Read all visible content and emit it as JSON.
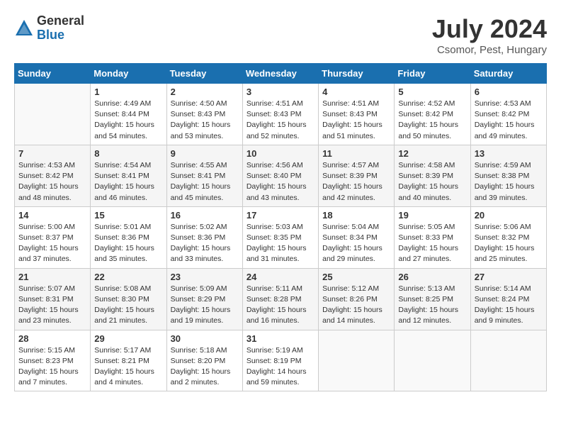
{
  "header": {
    "logo_general": "General",
    "logo_blue": "Blue",
    "month_title": "July 2024",
    "location": "Csomor, Pest, Hungary"
  },
  "days_header": [
    "Sunday",
    "Monday",
    "Tuesday",
    "Wednesday",
    "Thursday",
    "Friday",
    "Saturday"
  ],
  "weeks": [
    [
      {
        "day": "",
        "info": ""
      },
      {
        "day": "1",
        "info": "Sunrise: 4:49 AM\nSunset: 8:44 PM\nDaylight: 15 hours\nand 54 minutes."
      },
      {
        "day": "2",
        "info": "Sunrise: 4:50 AM\nSunset: 8:43 PM\nDaylight: 15 hours\nand 53 minutes."
      },
      {
        "day": "3",
        "info": "Sunrise: 4:51 AM\nSunset: 8:43 PM\nDaylight: 15 hours\nand 52 minutes."
      },
      {
        "day": "4",
        "info": "Sunrise: 4:51 AM\nSunset: 8:43 PM\nDaylight: 15 hours\nand 51 minutes."
      },
      {
        "day": "5",
        "info": "Sunrise: 4:52 AM\nSunset: 8:42 PM\nDaylight: 15 hours\nand 50 minutes."
      },
      {
        "day": "6",
        "info": "Sunrise: 4:53 AM\nSunset: 8:42 PM\nDaylight: 15 hours\nand 49 minutes."
      }
    ],
    [
      {
        "day": "7",
        "info": "Sunrise: 4:53 AM\nSunset: 8:42 PM\nDaylight: 15 hours\nand 48 minutes."
      },
      {
        "day": "8",
        "info": "Sunrise: 4:54 AM\nSunset: 8:41 PM\nDaylight: 15 hours\nand 46 minutes."
      },
      {
        "day": "9",
        "info": "Sunrise: 4:55 AM\nSunset: 8:41 PM\nDaylight: 15 hours\nand 45 minutes."
      },
      {
        "day": "10",
        "info": "Sunrise: 4:56 AM\nSunset: 8:40 PM\nDaylight: 15 hours\nand 43 minutes."
      },
      {
        "day": "11",
        "info": "Sunrise: 4:57 AM\nSunset: 8:39 PM\nDaylight: 15 hours\nand 42 minutes."
      },
      {
        "day": "12",
        "info": "Sunrise: 4:58 AM\nSunset: 8:39 PM\nDaylight: 15 hours\nand 40 minutes."
      },
      {
        "day": "13",
        "info": "Sunrise: 4:59 AM\nSunset: 8:38 PM\nDaylight: 15 hours\nand 39 minutes."
      }
    ],
    [
      {
        "day": "14",
        "info": "Sunrise: 5:00 AM\nSunset: 8:37 PM\nDaylight: 15 hours\nand 37 minutes."
      },
      {
        "day": "15",
        "info": "Sunrise: 5:01 AM\nSunset: 8:36 PM\nDaylight: 15 hours\nand 35 minutes."
      },
      {
        "day": "16",
        "info": "Sunrise: 5:02 AM\nSunset: 8:36 PM\nDaylight: 15 hours\nand 33 minutes."
      },
      {
        "day": "17",
        "info": "Sunrise: 5:03 AM\nSunset: 8:35 PM\nDaylight: 15 hours\nand 31 minutes."
      },
      {
        "day": "18",
        "info": "Sunrise: 5:04 AM\nSunset: 8:34 PM\nDaylight: 15 hours\nand 29 minutes."
      },
      {
        "day": "19",
        "info": "Sunrise: 5:05 AM\nSunset: 8:33 PM\nDaylight: 15 hours\nand 27 minutes."
      },
      {
        "day": "20",
        "info": "Sunrise: 5:06 AM\nSunset: 8:32 PM\nDaylight: 15 hours\nand 25 minutes."
      }
    ],
    [
      {
        "day": "21",
        "info": "Sunrise: 5:07 AM\nSunset: 8:31 PM\nDaylight: 15 hours\nand 23 minutes."
      },
      {
        "day": "22",
        "info": "Sunrise: 5:08 AM\nSunset: 8:30 PM\nDaylight: 15 hours\nand 21 minutes."
      },
      {
        "day": "23",
        "info": "Sunrise: 5:09 AM\nSunset: 8:29 PM\nDaylight: 15 hours\nand 19 minutes."
      },
      {
        "day": "24",
        "info": "Sunrise: 5:11 AM\nSunset: 8:28 PM\nDaylight: 15 hours\nand 16 minutes."
      },
      {
        "day": "25",
        "info": "Sunrise: 5:12 AM\nSunset: 8:26 PM\nDaylight: 15 hours\nand 14 minutes."
      },
      {
        "day": "26",
        "info": "Sunrise: 5:13 AM\nSunset: 8:25 PM\nDaylight: 15 hours\nand 12 minutes."
      },
      {
        "day": "27",
        "info": "Sunrise: 5:14 AM\nSunset: 8:24 PM\nDaylight: 15 hours\nand 9 minutes."
      }
    ],
    [
      {
        "day": "28",
        "info": "Sunrise: 5:15 AM\nSunset: 8:23 PM\nDaylight: 15 hours\nand 7 minutes."
      },
      {
        "day": "29",
        "info": "Sunrise: 5:17 AM\nSunset: 8:21 PM\nDaylight: 15 hours\nand 4 minutes."
      },
      {
        "day": "30",
        "info": "Sunrise: 5:18 AM\nSunset: 8:20 PM\nDaylight: 15 hours\nand 2 minutes."
      },
      {
        "day": "31",
        "info": "Sunrise: 5:19 AM\nSunset: 8:19 PM\nDaylight: 14 hours\nand 59 minutes."
      },
      {
        "day": "",
        "info": ""
      },
      {
        "day": "",
        "info": ""
      },
      {
        "day": "",
        "info": ""
      }
    ]
  ]
}
